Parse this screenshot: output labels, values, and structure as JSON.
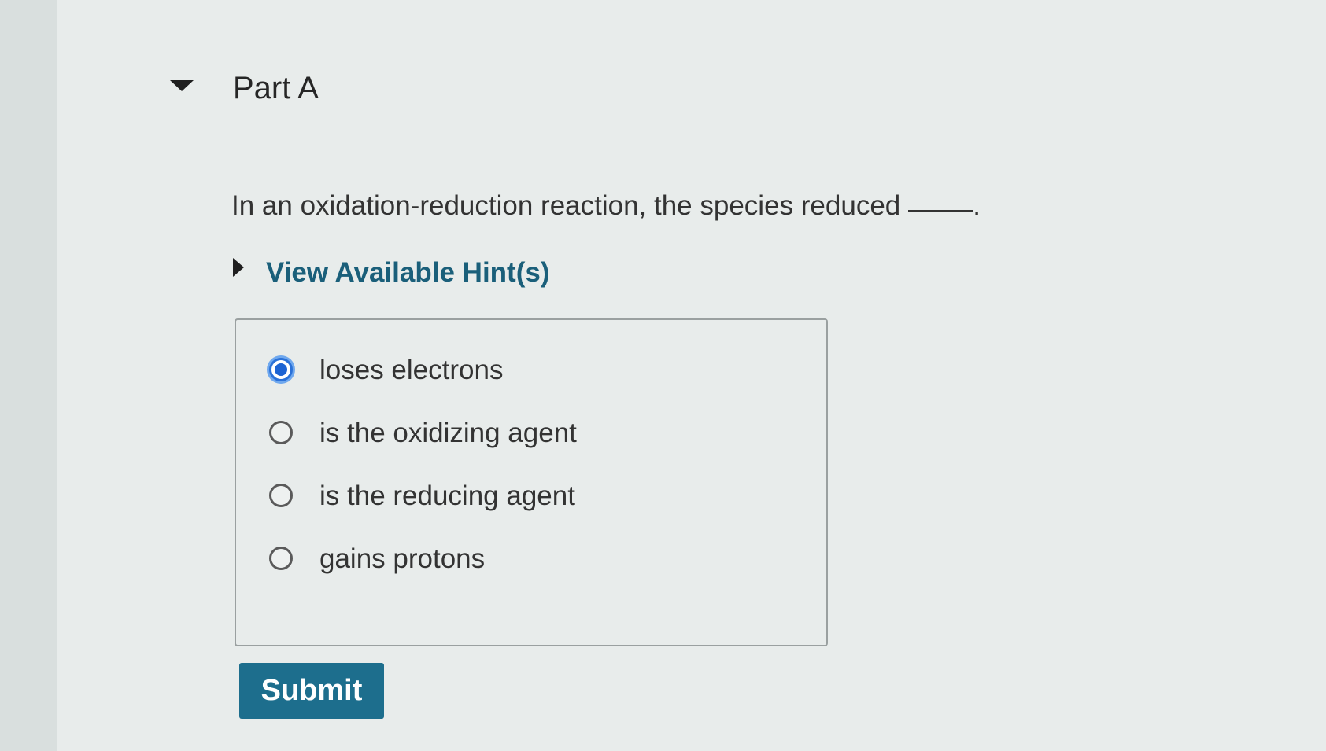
{
  "part": {
    "title": "Part A"
  },
  "question": {
    "text": "In an oxidation-reduction reaction, the species reduced",
    "blank_suffix": "."
  },
  "hints": {
    "label": "View Available Hint(s)"
  },
  "options": [
    {
      "label": "loses electrons",
      "selected": true
    },
    {
      "label": "is the oxidizing agent",
      "selected": false
    },
    {
      "label": "is the reducing agent",
      "selected": false
    },
    {
      "label": "gains protons",
      "selected": false
    }
  ],
  "submit": {
    "label": "Submit"
  },
  "colors": {
    "accent": "#1d6e8d",
    "link": "#1a5f7a",
    "radio_selected": "#1c63d3"
  }
}
